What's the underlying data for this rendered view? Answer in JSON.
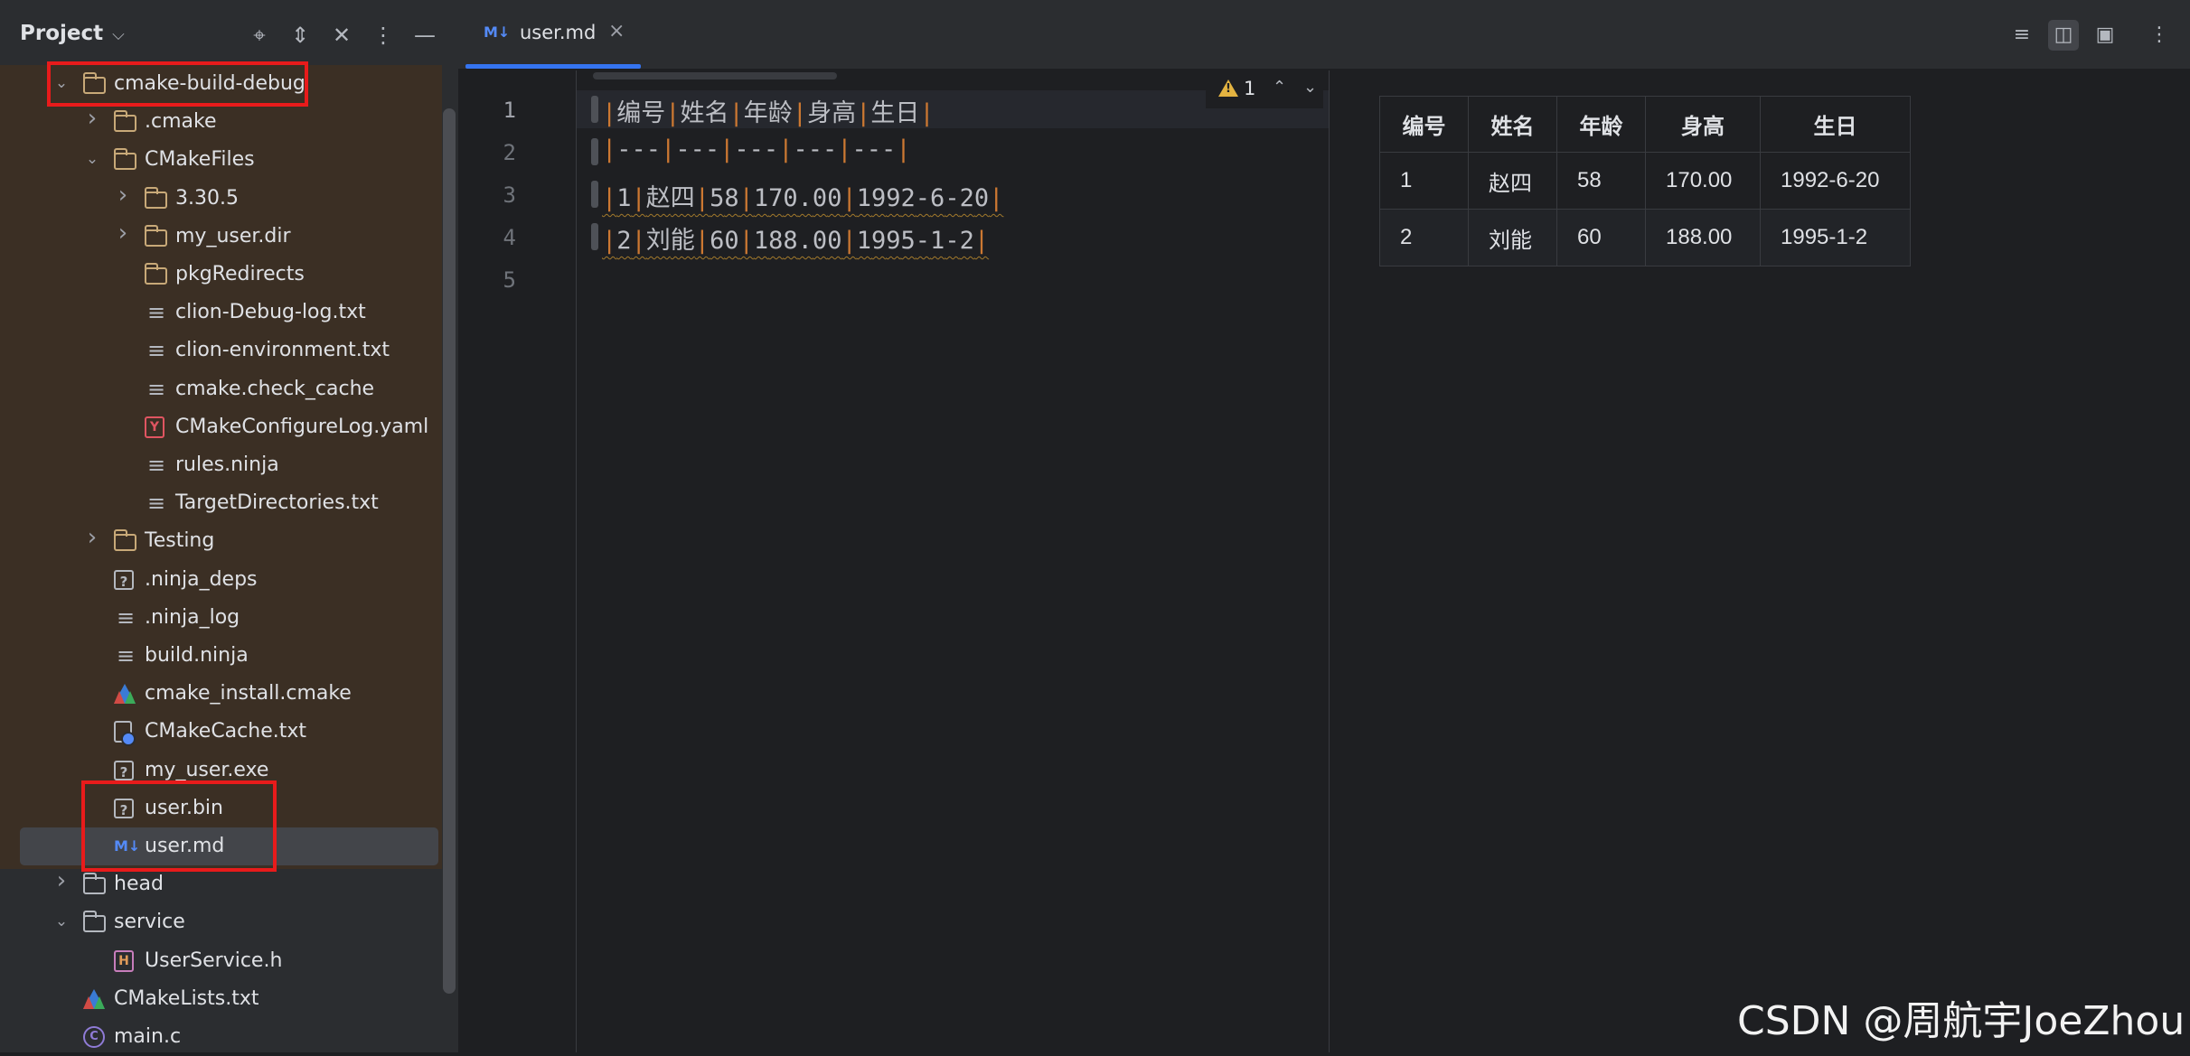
{
  "project_panel": {
    "title": "Project",
    "title_chevron": "⌵",
    "header_icons": [
      "crosshair-icon",
      "expand-icon",
      "collapse-icon",
      "more-icon",
      "minimize-icon"
    ]
  },
  "tree": [
    {
      "label": "cmake-build-debug",
      "indent": 1,
      "arrow": "expanded",
      "icon": "folder"
    },
    {
      "label": ".cmake",
      "indent": 2,
      "arrow": "collapsed",
      "icon": "folder"
    },
    {
      "label": "CMakeFiles",
      "indent": 2,
      "arrow": "expanded",
      "icon": "folder"
    },
    {
      "label": "3.30.5",
      "indent": 3,
      "arrow": "collapsed",
      "icon": "folder"
    },
    {
      "label": "my_user.dir",
      "indent": 3,
      "arrow": "collapsed",
      "icon": "folder"
    },
    {
      "label": "pkgRedirects",
      "indent": 3,
      "arrow": "none",
      "icon": "folder"
    },
    {
      "label": "clion-Debug-log.txt",
      "indent": 3,
      "arrow": "none",
      "icon": "text"
    },
    {
      "label": "clion-environment.txt",
      "indent": 3,
      "arrow": "none",
      "icon": "text"
    },
    {
      "label": "cmake.check_cache",
      "indent": 3,
      "arrow": "none",
      "icon": "text"
    },
    {
      "label": "CMakeConfigureLog.yaml",
      "indent": 3,
      "arrow": "none",
      "icon": "yaml"
    },
    {
      "label": "rules.ninja",
      "indent": 3,
      "arrow": "none",
      "icon": "text"
    },
    {
      "label": "TargetDirectories.txt",
      "indent": 3,
      "arrow": "none",
      "icon": "text"
    },
    {
      "label": "Testing",
      "indent": 2,
      "arrow": "collapsed",
      "icon": "folder"
    },
    {
      "label": ".ninja_deps",
      "indent": 2,
      "arrow": "none",
      "icon": "unknown"
    },
    {
      "label": ".ninja_log",
      "indent": 2,
      "arrow": "none",
      "icon": "text"
    },
    {
      "label": "build.ninja",
      "indent": 2,
      "arrow": "none",
      "icon": "text"
    },
    {
      "label": "cmake_install.cmake",
      "indent": 2,
      "arrow": "none",
      "icon": "cmake"
    },
    {
      "label": "CMakeCache.txt",
      "indent": 2,
      "arrow": "none",
      "icon": "cache"
    },
    {
      "label": "my_user.exe",
      "indent": 2,
      "arrow": "none",
      "icon": "unknown"
    },
    {
      "label": "user.bin",
      "indent": 2,
      "arrow": "none",
      "icon": "unknown"
    },
    {
      "label": "user.md",
      "indent": 2,
      "arrow": "none",
      "icon": "markdown",
      "selected": true
    },
    {
      "label": "head",
      "indent": 1,
      "arrow": "collapsed",
      "icon": "folder-plain"
    },
    {
      "label": "service",
      "indent": 1,
      "arrow": "expanded",
      "icon": "folder-plain"
    },
    {
      "label": "UserService.h",
      "indent": 2,
      "arrow": "none",
      "icon": "header"
    },
    {
      "label": "CMakeLists.txt",
      "indent": 1,
      "arrow": "none",
      "icon": "cmake"
    },
    {
      "label": "main.c",
      "indent": 1,
      "arrow": "none",
      "icon": "c"
    }
  ],
  "tab": {
    "icon_text": "M↓",
    "label": "user.md",
    "close": "×"
  },
  "toolbar_icons": [
    "editor-only-icon",
    "split-view-icon",
    "preview-only-icon",
    "more-icon"
  ],
  "gutter": {
    "line_numbers": [
      "1",
      "2",
      "3",
      "4",
      "5"
    ]
  },
  "code_lines": [
    "|编号|姓名|年龄|身高|生日|",
    "|---|---|---|---|---|",
    "|1|赵四|58|170.00|1992-6-20|",
    "|2|刘能|60|188.00|1995-1-2|",
    ""
  ],
  "warnings": {
    "count": "1",
    "up": "⌃",
    "down": "⌄"
  },
  "preview_table": {
    "headers": [
      "编号",
      "姓名",
      "年龄",
      "身高",
      "生日"
    ],
    "rows": [
      [
        "1",
        "赵四",
        "58",
        "170.00",
        "1992-6-20"
      ],
      [
        "2",
        "刘能",
        "60",
        "188.00",
        "1995-1-2"
      ]
    ]
  },
  "watermark": "CSDN @周航宇JoeZhou",
  "colors": {
    "accent": "#3574f0",
    "highlight_box": "#e81b1b",
    "tree_band": "#3b2f24",
    "markdown_pipe": "#cc7832"
  }
}
